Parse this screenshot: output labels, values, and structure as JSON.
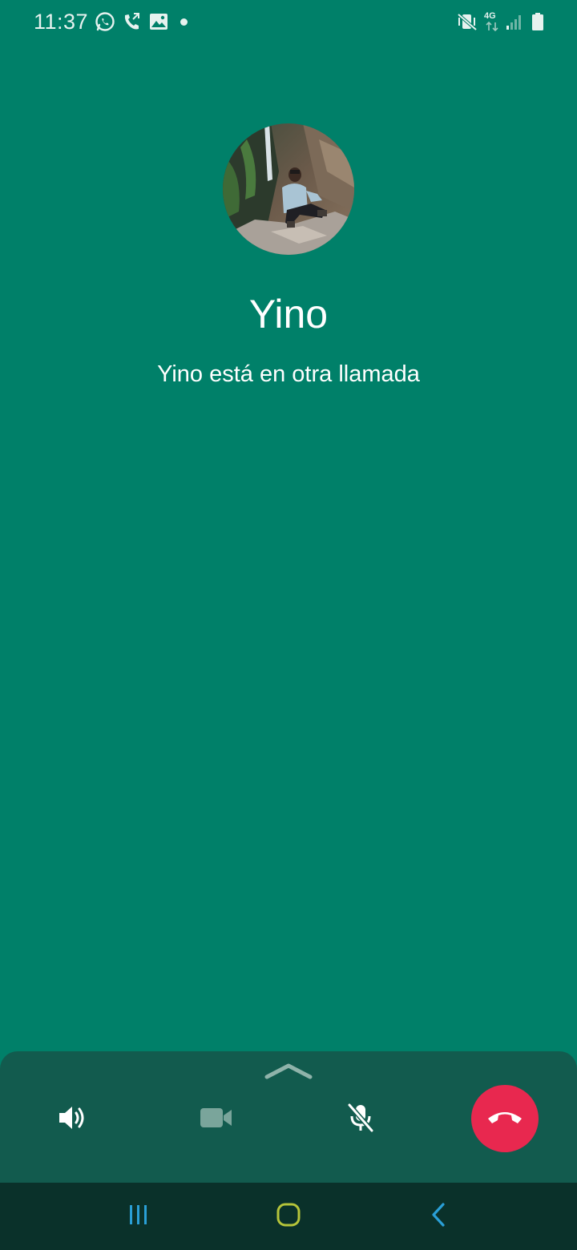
{
  "status_bar": {
    "time": "11:37",
    "network_label": "4G",
    "icons": [
      "whatsapp-icon",
      "wifi-call-icon",
      "gallery-icon",
      "notification-dot",
      "vibrate-mute-icon",
      "4g-data-icon",
      "signal-icon",
      "battery-icon"
    ]
  },
  "call": {
    "contact_name": "Yino",
    "status_text": "Yino está en otra llamada"
  },
  "controls": {
    "icons": [
      "speaker-icon",
      "video-icon",
      "mic-off-icon",
      "end-call-icon"
    ]
  },
  "navigation": {
    "icons": [
      "recent-apps-icon",
      "home-icon",
      "back-icon"
    ]
  },
  "colors": {
    "background": "#008069",
    "panel": "#125b4e",
    "end_call": "#e8284f",
    "nav_bar": "#0a312a",
    "nav_recent": "#2a9fd6",
    "nav_home": "#b5c43a",
    "nav_back": "#2a9fd6"
  }
}
